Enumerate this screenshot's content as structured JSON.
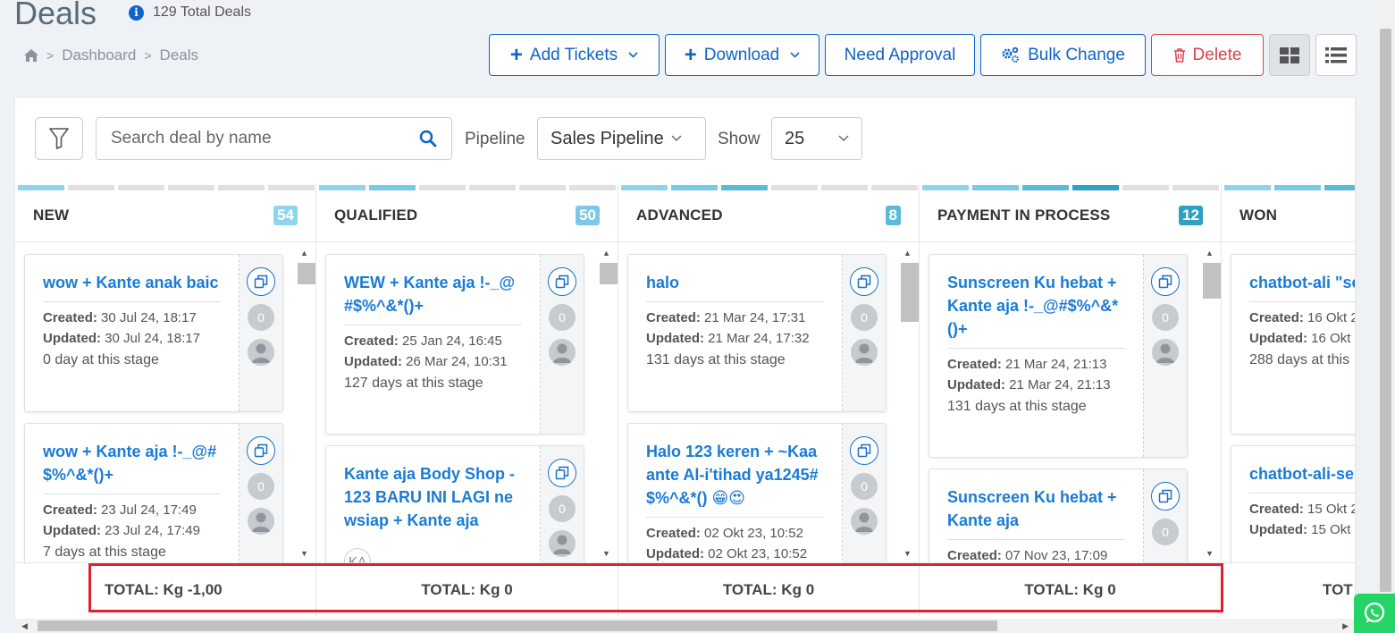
{
  "header": {
    "title": "Deals",
    "total_deals": "129 Total Deals"
  },
  "breadcrumb": {
    "home": "home-icon",
    "items": [
      "Dashboard",
      "Deals"
    ]
  },
  "toolbar": {
    "add_tickets": "Add Tickets",
    "download": "Download",
    "need_approval": "Need Approval",
    "bulk_change": "Bulk Change",
    "delete": "Delete"
  },
  "filters": {
    "search_placeholder": "Search deal by name",
    "pipeline_label": "Pipeline",
    "pipeline_value": "Sales Pipeline",
    "show_label": "Show",
    "show_value": "25"
  },
  "colors": {
    "primary": "#0f63c9",
    "danger": "#e0404b",
    "link": "#1a7bd6",
    "highlight": "#e0222e"
  },
  "columns": [
    {
      "title": "NEW",
      "count": "54",
      "count_color": "#8fd3ee",
      "cards": [
        {
          "title": "wow + Kante anak baic",
          "created": "30 Jul 24, 18:17",
          "updated": "30 Jul 24, 18:17",
          "stage": "0 day at this stage",
          "counter": "0"
        },
        {
          "title": "wow + Kante aja !-_@#$%^&*()+",
          "created": "23 Jul 24, 17:49",
          "updated": "23 Jul 24, 17:49",
          "stage": "7 days at this stage",
          "counter": "0"
        }
      ],
      "total": "TOTAL: Kg -1,00"
    },
    {
      "title": "QUALIFIED",
      "count": "50",
      "count_color": "#7cc8e8",
      "cards": [
        {
          "title": "WEW + Kante aja !-_@#$%^&*()+",
          "created": "25 Jan 24, 16:45",
          "updated": "26 Mar 24, 10:31",
          "stage": "127 days at this stage",
          "counter": "0"
        },
        {
          "title": "Kante aja Body Shop - 123 BARU INI LAGI newsiap + Kante aja",
          "badge": "KA",
          "counter": "0"
        }
      ],
      "total": "TOTAL: Kg 0"
    },
    {
      "title": "ADVANCED",
      "count": "8",
      "count_color": "#5bbad9",
      "cards": [
        {
          "title": "halo",
          "created": "21 Mar 24, 17:31",
          "updated": "21 Mar 24, 17:32",
          "stage": "131 days at this stage",
          "counter": "0"
        },
        {
          "title": "Halo 123 keren + ~Kaaante Al-i'tihad ya1245#$%^&*() 😁😍",
          "created": "02 Okt 23, 10:52",
          "updated": "02 Okt 23, 10:52",
          "counter": "0"
        }
      ],
      "total": "TOTAL: Kg 0"
    },
    {
      "title": "PAYMENT IN PROCESS",
      "count": "12",
      "count_color": "#2f9fc4",
      "cards": [
        {
          "title": "Sunscreen Ku hebat + Kante aja !-_@#$%^&*()+",
          "created": "21 Mar 24, 21:13",
          "updated": "21 Mar 24, 21:13",
          "stage": "131 days at this stage",
          "counter": "0"
        },
        {
          "title": "Sunscreen Ku hebat + Kante aja",
          "created": "07 Nov 23, 17:09",
          "counter": "0"
        }
      ],
      "total": "TOTAL: Kg 0"
    },
    {
      "title": "WON",
      "cards": [
        {
          "title": "chatbot-ali \"se Kante aja",
          "created": "16 Okt 2",
          "updated": "16 Okt",
          "stage": "288 days at this"
        },
        {
          "title": "chatbot-ali-se Kante aja",
          "created": "15 Okt 2",
          "updated": "15 Okt"
        }
      ],
      "total": "TOT"
    }
  ],
  "labels": {
    "created": "Created:",
    "updated": "Updated:"
  }
}
